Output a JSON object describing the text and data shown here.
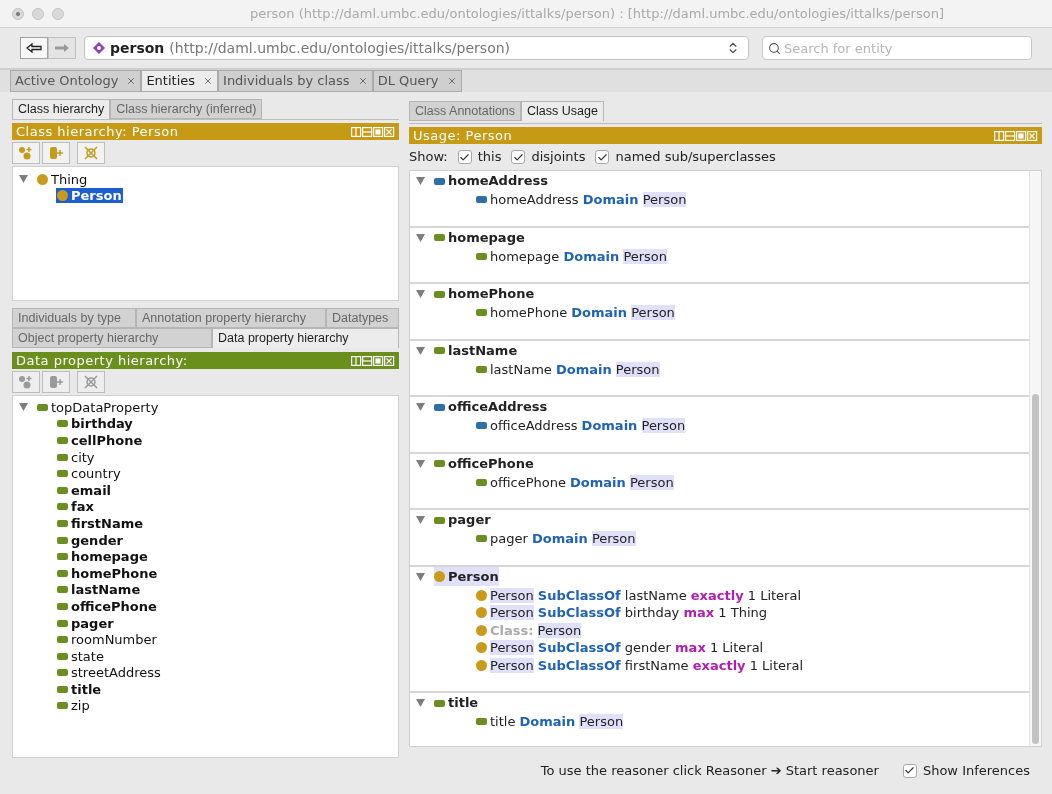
{
  "window": {
    "title": "person (http://daml.umbc.edu/ontologies/ittalks/person)  : [http://daml.umbc.edu/ontologies/ittalks/person]"
  },
  "address": {
    "name": "person",
    "iri": "(http://daml.umbc.edu/ontologies/ittalks/person)"
  },
  "search": {
    "placeholder": "Search for entity"
  },
  "tabs": [
    {
      "label": "Active Ontology",
      "selected": false
    },
    {
      "label": "Entities",
      "selected": true
    },
    {
      "label": "Individuals by class",
      "selected": false
    },
    {
      "label": "DL Query",
      "selected": false
    }
  ],
  "class_panel": {
    "tabs": [
      {
        "label": "Class hierarchy",
        "selected": true
      },
      {
        "label": "Class hierarchy (inferred)",
        "selected": false
      }
    ],
    "header": "Class hierarchy: Person",
    "kind": "class",
    "tools_disabled": false,
    "tree": [
      {
        "label": "Thing",
        "selected": false,
        "expanded": true,
        "children": [
          {
            "label": "Person",
            "selected": true
          }
        ]
      }
    ]
  },
  "property_panel": {
    "tab_rows": [
      [
        {
          "label": "Individuals by type",
          "selected": false
        },
        {
          "label": "Annotation property hierarchy",
          "selected": false
        },
        {
          "label": "Datatypes",
          "selected": false
        }
      ],
      [
        {
          "label": "Object property hierarchy",
          "selected": false
        },
        {
          "label": "Data property hierarchy",
          "selected": true
        }
      ]
    ],
    "header": "Data property hierarchy:",
    "kind": "data",
    "tools_disabled": true,
    "tree": [
      {
        "label": "topDataProperty",
        "expanded": true,
        "bold": false,
        "children": [
          {
            "label": "birthday",
            "bold": true
          },
          {
            "label": "cellPhone",
            "bold": true
          },
          {
            "label": "city",
            "bold": false
          },
          {
            "label": "country",
            "bold": false
          },
          {
            "label": "email",
            "bold": true
          },
          {
            "label": "fax",
            "bold": true
          },
          {
            "label": "firstName",
            "bold": true
          },
          {
            "label": "gender",
            "bold": true
          },
          {
            "label": "homepage",
            "bold": true
          },
          {
            "label": "homePhone",
            "bold": true
          },
          {
            "label": "lastName",
            "bold": true
          },
          {
            "label": "officePhone",
            "bold": true
          },
          {
            "label": "pager",
            "bold": true
          },
          {
            "label": "roomNumber",
            "bold": false
          },
          {
            "label": "state",
            "bold": false
          },
          {
            "label": "streetAddress",
            "bold": false
          },
          {
            "label": "title",
            "bold": true
          },
          {
            "label": "zip",
            "bold": false
          }
        ]
      }
    ]
  },
  "usage_panel": {
    "tabs": [
      {
        "label": "Class Annotations",
        "selected": false
      },
      {
        "label": "Class Usage",
        "selected": true
      }
    ],
    "header": "Usage: Person",
    "kind": "class",
    "show_label": "Show:",
    "filters": [
      {
        "label": "this",
        "checked": true
      },
      {
        "label": "disjoints",
        "checked": true
      },
      {
        "label": "named sub/superclasses",
        "checked": true
      }
    ],
    "sections": [
      {
        "title": "homeAddress",
        "kind": "object",
        "highlighted": false,
        "expanded": true,
        "lines": [
          {
            "kind": "object",
            "tokens": [
              {
                "kind": "plain",
                "text": "homeAddress"
              },
              {
                "kind": "keyword",
                "text": "Domain"
              },
              {
                "kind": "entity",
                "text": "Person"
              }
            ]
          }
        ]
      },
      {
        "title": "homepage",
        "kind": "data",
        "highlighted": false,
        "expanded": true,
        "lines": [
          {
            "kind": "data",
            "tokens": [
              {
                "kind": "plain",
                "text": "homepage"
              },
              {
                "kind": "keyword",
                "text": "Domain"
              },
              {
                "kind": "entity",
                "text": "Person"
              }
            ]
          }
        ]
      },
      {
        "title": "homePhone",
        "kind": "data",
        "highlighted": false,
        "expanded": true,
        "lines": [
          {
            "kind": "data",
            "tokens": [
              {
                "kind": "plain",
                "text": "homePhone"
              },
              {
                "kind": "keyword",
                "text": "Domain"
              },
              {
                "kind": "entity",
                "text": "Person"
              }
            ]
          }
        ]
      },
      {
        "title": "lastName",
        "kind": "data",
        "highlighted": false,
        "expanded": true,
        "lines": [
          {
            "kind": "data",
            "tokens": [
              {
                "kind": "plain",
                "text": "lastName"
              },
              {
                "kind": "keyword",
                "text": "Domain"
              },
              {
                "kind": "entity",
                "text": "Person"
              }
            ]
          }
        ]
      },
      {
        "title": "officeAddress",
        "kind": "object",
        "highlighted": false,
        "expanded": true,
        "lines": [
          {
            "kind": "object",
            "tokens": [
              {
                "kind": "plain",
                "text": "officeAddress"
              },
              {
                "kind": "keyword",
                "text": "Domain"
              },
              {
                "kind": "entity",
                "text": "Person"
              }
            ]
          }
        ]
      },
      {
        "title": "officePhone",
        "kind": "data",
        "highlighted": false,
        "expanded": true,
        "lines": [
          {
            "kind": "data",
            "tokens": [
              {
                "kind": "plain",
                "text": "officePhone"
              },
              {
                "kind": "keyword",
                "text": "Domain"
              },
              {
                "kind": "entity",
                "text": "Person"
              }
            ]
          }
        ]
      },
      {
        "title": "pager",
        "kind": "data",
        "highlighted": false,
        "expanded": true,
        "lines": [
          {
            "kind": "data",
            "tokens": [
              {
                "kind": "plain",
                "text": "pager"
              },
              {
                "kind": "keyword",
                "text": "Domain"
              },
              {
                "kind": "entity",
                "text": "Person"
              }
            ]
          }
        ]
      },
      {
        "title": "Person",
        "kind": "class",
        "highlighted": true,
        "expanded": true,
        "lines": [
          {
            "kind": "class",
            "tokens": [
              {
                "kind": "entity",
                "text": "Person"
              },
              {
                "kind": "keyword",
                "text": "SubClassOf"
              },
              {
                "kind": "plain",
                "text": "lastName"
              },
              {
                "kind": "restriction",
                "text": "exactly"
              },
              {
                "kind": "plain",
                "text": "1 Literal"
              }
            ]
          },
          {
            "kind": "class",
            "tokens": [
              {
                "kind": "entity",
                "text": "Person"
              },
              {
                "kind": "keyword",
                "text": "SubClassOf"
              },
              {
                "kind": "plain",
                "text": "birthday"
              },
              {
                "kind": "restriction",
                "text": "max"
              },
              {
                "kind": "plain",
                "text": "1 Thing"
              }
            ]
          },
          {
            "kind": "class",
            "tokens": [
              {
                "kind": "label",
                "text": "Class:"
              },
              {
                "kind": "entity",
                "text": "Person"
              }
            ]
          },
          {
            "kind": "class",
            "tokens": [
              {
                "kind": "entity",
                "text": "Person"
              },
              {
                "kind": "keyword",
                "text": "SubClassOf"
              },
              {
                "kind": "plain",
                "text": "gender"
              },
              {
                "kind": "restriction",
                "text": "max"
              },
              {
                "kind": "plain",
                "text": "1 Literal"
              }
            ]
          },
          {
            "kind": "class",
            "tokens": [
              {
                "kind": "entity",
                "text": "Person"
              },
              {
                "kind": "keyword",
                "text": "SubClassOf"
              },
              {
                "kind": "plain",
                "text": "firstName"
              },
              {
                "kind": "restriction",
                "text": "exactly"
              },
              {
                "kind": "plain",
                "text": "1 Literal"
              }
            ]
          }
        ]
      },
      {
        "title": "title",
        "kind": "data",
        "highlighted": false,
        "expanded": true,
        "lines": [
          {
            "kind": "data",
            "tokens": [
              {
                "kind": "plain",
                "text": "title"
              },
              {
                "kind": "keyword",
                "text": "Domain"
              },
              {
                "kind": "entity",
                "text": "Person"
              }
            ]
          }
        ]
      }
    ]
  },
  "status_bar": {
    "message": "To use the reasoner click Reasoner ➔ Start reasoner",
    "inferences": {
      "label": "Show Inferences",
      "checked": true
    }
  }
}
